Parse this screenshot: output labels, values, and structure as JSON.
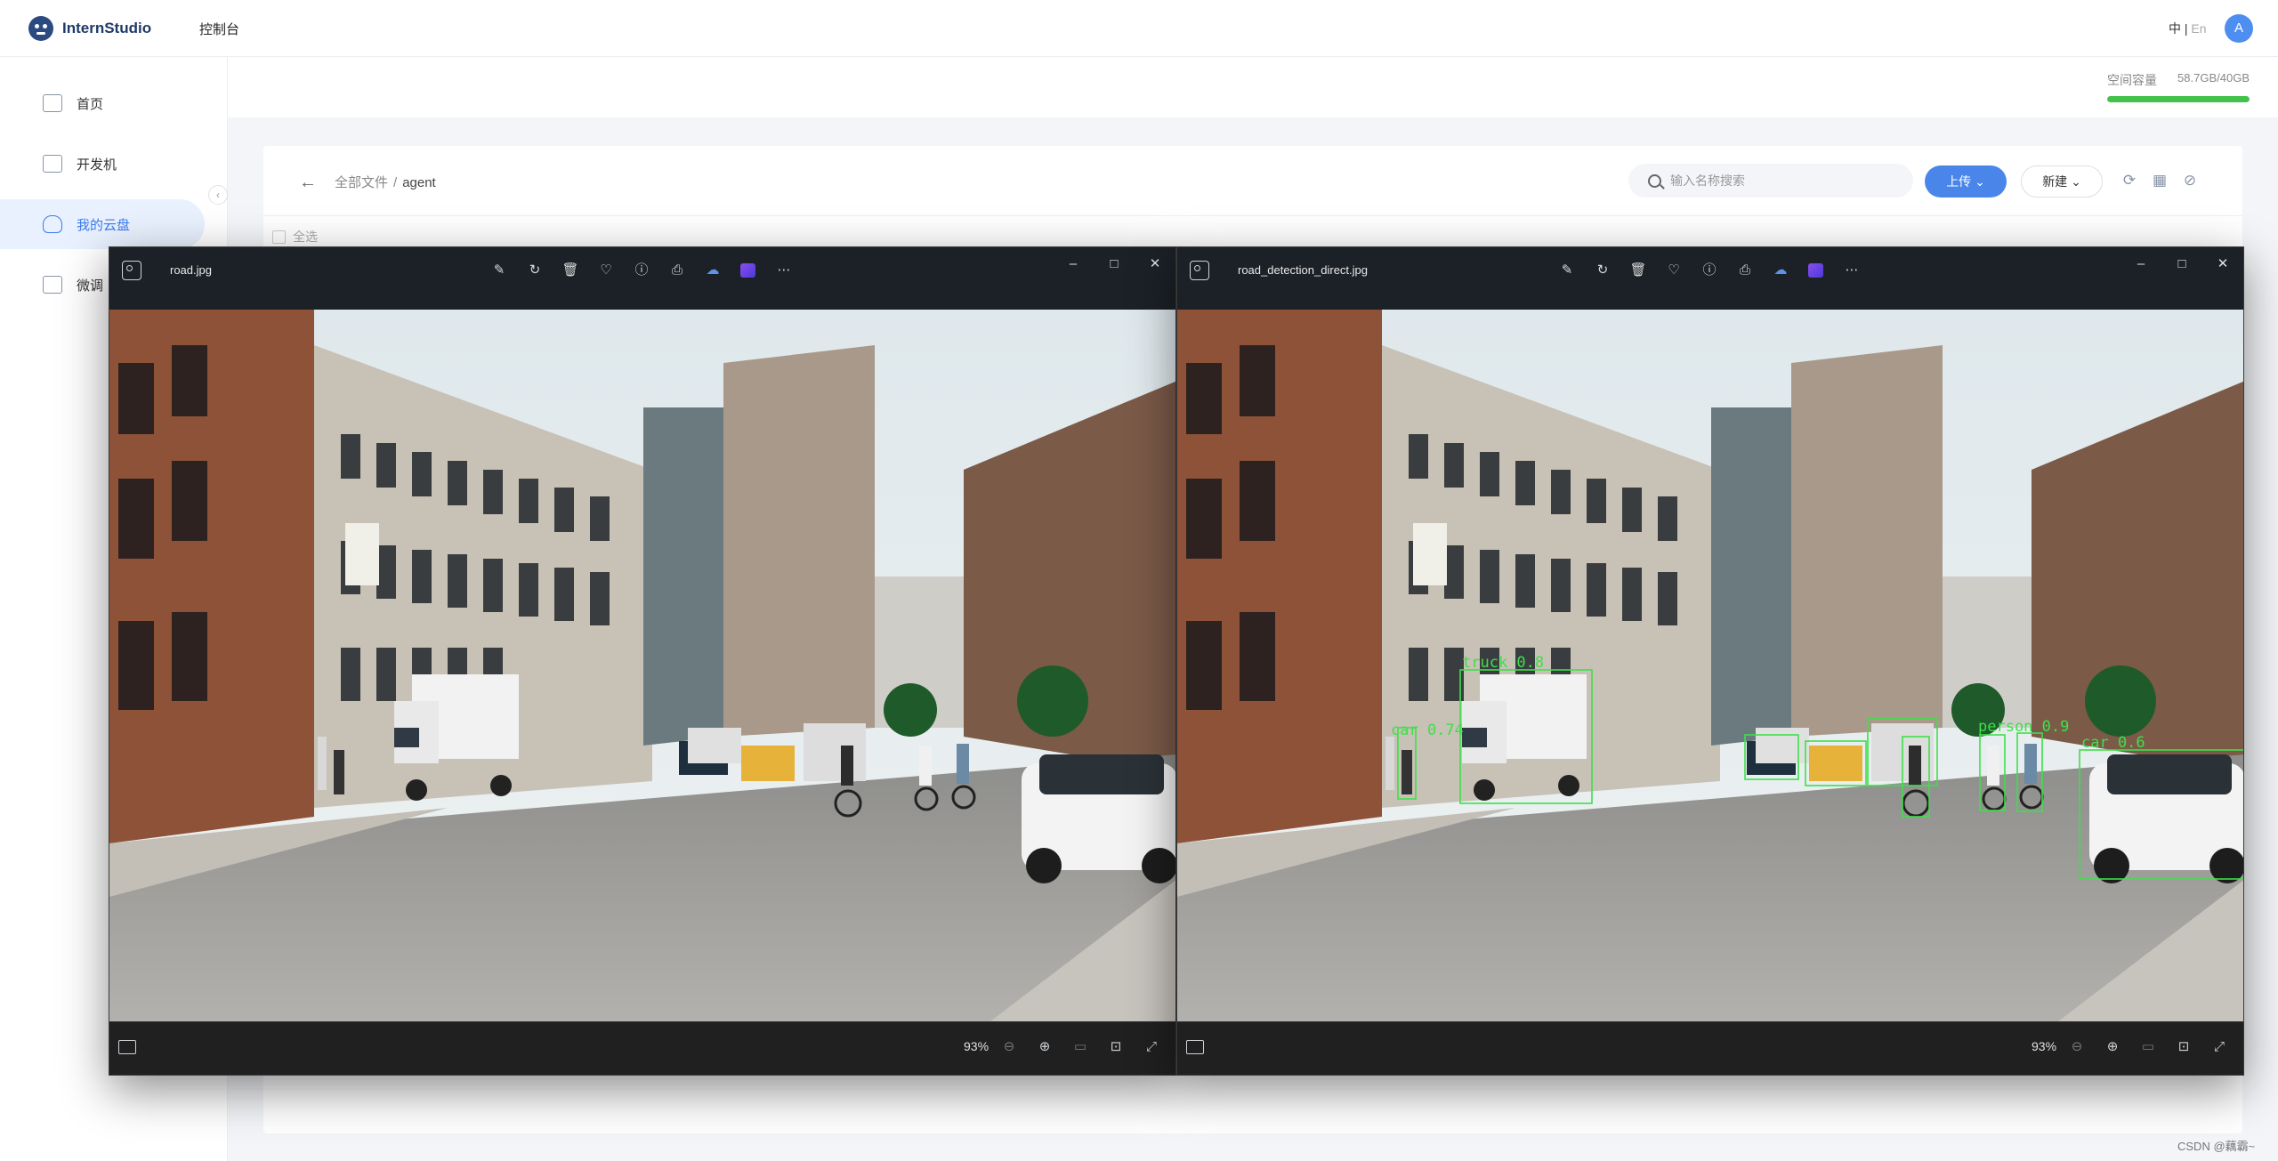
{
  "header": {
    "logo_text": "InternStudio",
    "console_label": "控制台",
    "lang_zh": "中",
    "lang_sep": "|",
    "lang_en": "En",
    "avatar_letter": "A"
  },
  "sidebar": {
    "items": [
      {
        "label": "首页",
        "icon": "home-icon",
        "active": false
      },
      {
        "label": "开发机",
        "icon": "devmachine-icon",
        "active": false
      },
      {
        "label": "我的云盘",
        "icon": "cloud-drive-icon",
        "active": true
      },
      {
        "label": "微调",
        "icon": "layers-icon",
        "active": false
      }
    ],
    "collapse_glyph": "‹"
  },
  "storage": {
    "label": "空间容量",
    "value": "58.7GB/40GB",
    "fill_fraction": 1.0,
    "color": "#43c14a"
  },
  "files": {
    "back_glyph": "←",
    "breadcrumb": [
      "全部文件",
      "agent"
    ],
    "search_placeholder": "输入名称搜索",
    "upload_label": "上传 ⌄",
    "new_label": "新建 ⌄",
    "select_all_label": "全选"
  },
  "viewers": [
    {
      "filename": "road.jpg",
      "zoom": "93%"
    },
    {
      "filename": "road_detection_direct.jpg",
      "zoom": "93%",
      "detection_labels": [
        "car 0.74",
        "truck 0.8",
        "person 0.9",
        "car 0.6"
      ]
    }
  ],
  "watermark": "CSDN @藕霸~"
}
